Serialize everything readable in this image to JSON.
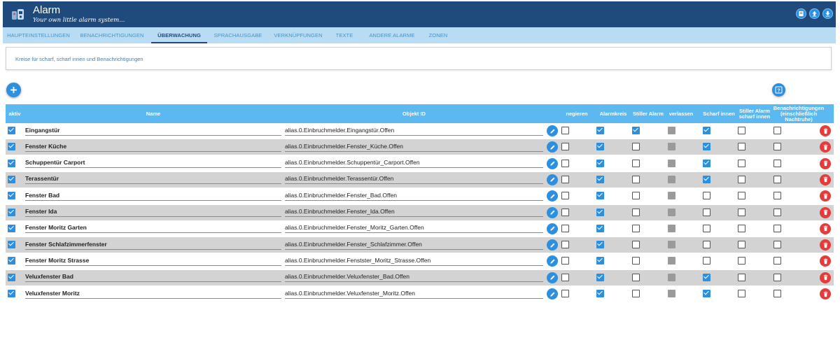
{
  "app": {
    "title": "Alarm",
    "subtitle": "Your own little alarm system..."
  },
  "tabs": [
    {
      "label": "Haupteinstellungen",
      "active": false
    },
    {
      "label": "Benachrichtigungen",
      "active": false
    },
    {
      "label": "Überwachung",
      "active": true
    },
    {
      "label": "Sprachausgabe",
      "active": false
    },
    {
      "label": "Verknüpfungen",
      "active": false
    },
    {
      "label": "Texte",
      "active": false
    },
    {
      "label": "Andere Alarme",
      "active": false
    },
    {
      "label": "Zonen",
      "active": false
    }
  ],
  "info": {
    "text": "Kreise für scharf, scharf innen und Benachrichtigungen"
  },
  "table": {
    "headers": {
      "aktiv": "aktiv",
      "name": "Name",
      "objekt_id": "Objekt ID",
      "negieren": "negieren",
      "alarmkreis": "Alarmkreis",
      "stiller_alarm": "Stiller Alarm",
      "verlassen": "verlassen",
      "scharf_innen": "Scharf innen",
      "stiller_alarm_scharf_innen": "Stiller Alarm scharf innen",
      "benachrichtigungen": "Benachrichtigungen (einschließlich Nachtruhe)"
    },
    "rows": [
      {
        "name": "Eingangstür",
        "object_id": "alias.0.Einbruchmelder.Eingangstür.Offen",
        "aktiv": true,
        "negieren": false,
        "alarmkreis": true,
        "stiller_alarm": true,
        "verlassen": "disabled",
        "scharf_innen": true,
        "stiller_alarm_scharf_innen": false,
        "benachrichtigungen": false
      },
      {
        "name": "Fenster Küche",
        "object_id": "alias.0.Einbruchmelder.Fenster_Küche.Offen",
        "aktiv": true,
        "negieren": false,
        "alarmkreis": true,
        "stiller_alarm": false,
        "verlassen": "disabled",
        "scharf_innen": true,
        "stiller_alarm_scharf_innen": false,
        "benachrichtigungen": false
      },
      {
        "name": "Schuppentür Carport",
        "object_id": "alias.0.Einbruchmelder.Schuppentür_Carport.Offen",
        "aktiv": true,
        "negieren": false,
        "alarmkreis": true,
        "stiller_alarm": false,
        "verlassen": "disabled",
        "scharf_innen": true,
        "stiller_alarm_scharf_innen": false,
        "benachrichtigungen": false
      },
      {
        "name": "Terassentür",
        "object_id": "alias.0.Einbruchmelder.Terassentür.Offen",
        "aktiv": true,
        "negieren": false,
        "alarmkreis": true,
        "stiller_alarm": false,
        "verlassen": "disabled",
        "scharf_innen": true,
        "stiller_alarm_scharf_innen": false,
        "benachrichtigungen": false
      },
      {
        "name": "Fenster Bad",
        "object_id": "alias.0.Einbruchmelder.Fenster_Bad.Offen",
        "aktiv": true,
        "negieren": false,
        "alarmkreis": true,
        "stiller_alarm": false,
        "verlassen": "disabled",
        "scharf_innen": false,
        "stiller_alarm_scharf_innen": false,
        "benachrichtigungen": false
      },
      {
        "name": "Fenster Ida",
        "object_id": "alias.0.Einbruchmelder.Fenster_Ida.Offen",
        "aktiv": true,
        "negieren": false,
        "alarmkreis": true,
        "stiller_alarm": false,
        "verlassen": "disabled",
        "scharf_innen": false,
        "stiller_alarm_scharf_innen": false,
        "benachrichtigungen": false
      },
      {
        "name": "Fenster Moritz Garten",
        "object_id": "alias.0.Einbruchmelder.Fenster_Moritz_Garten.Offen",
        "aktiv": true,
        "negieren": false,
        "alarmkreis": true,
        "stiller_alarm": false,
        "verlassen": "disabled",
        "scharf_innen": false,
        "stiller_alarm_scharf_innen": false,
        "benachrichtigungen": false
      },
      {
        "name": "Fenster Schlafzimmerfenster",
        "object_id": "alias.0.Einbruchmelder.Fenster_Schlafzimmer.Offen",
        "aktiv": true,
        "negieren": false,
        "alarmkreis": true,
        "stiller_alarm": false,
        "verlassen": "disabled",
        "scharf_innen": false,
        "stiller_alarm_scharf_innen": false,
        "benachrichtigungen": false
      },
      {
        "name": "Fenster Moritz Strasse",
        "object_id": "alias.0.Einbruchmelder.Fenstster_Moritz_Strasse.Offen",
        "aktiv": true,
        "negieren": false,
        "alarmkreis": true,
        "stiller_alarm": false,
        "verlassen": "disabled",
        "scharf_innen": false,
        "stiller_alarm_scharf_innen": false,
        "benachrichtigungen": false
      },
      {
        "name": "Veluxfenster Bad",
        "object_id": "alias.0.Einbruchmelder.Veluxfenster_Bad.Offen",
        "aktiv": true,
        "negieren": false,
        "alarmkreis": true,
        "stiller_alarm": false,
        "verlassen": "disabled",
        "scharf_innen": true,
        "stiller_alarm_scharf_innen": false,
        "benachrichtigungen": false
      },
      {
        "name": "Veluxfenster Moritz",
        "object_id": "alias.0.Einbruchmelder.Veluxfenster_Moritz.Offen",
        "aktiv": true,
        "negieren": false,
        "alarmkreis": true,
        "stiller_alarm": false,
        "verlassen": "disabled",
        "scharf_innen": true,
        "stiller_alarm_scharf_innen": false,
        "benachrichtigungen": false
      }
    ]
  },
  "icons": {
    "logo": "alarm-logo-icon",
    "header_buttons": [
      "book-icon",
      "upload-icon",
      "download-icon"
    ],
    "add": "plus-icon",
    "help": "help-icon",
    "edit": "pencil-icon",
    "delete": "trash-icon"
  },
  "colors": {
    "header": "#1f4a7c",
    "tabs_bar": "#b8dcf4",
    "table_header": "#5bb8f0",
    "accent": "#2d8fe0",
    "delete": "#e53b3b",
    "row_alt": "#d3d3d3"
  }
}
